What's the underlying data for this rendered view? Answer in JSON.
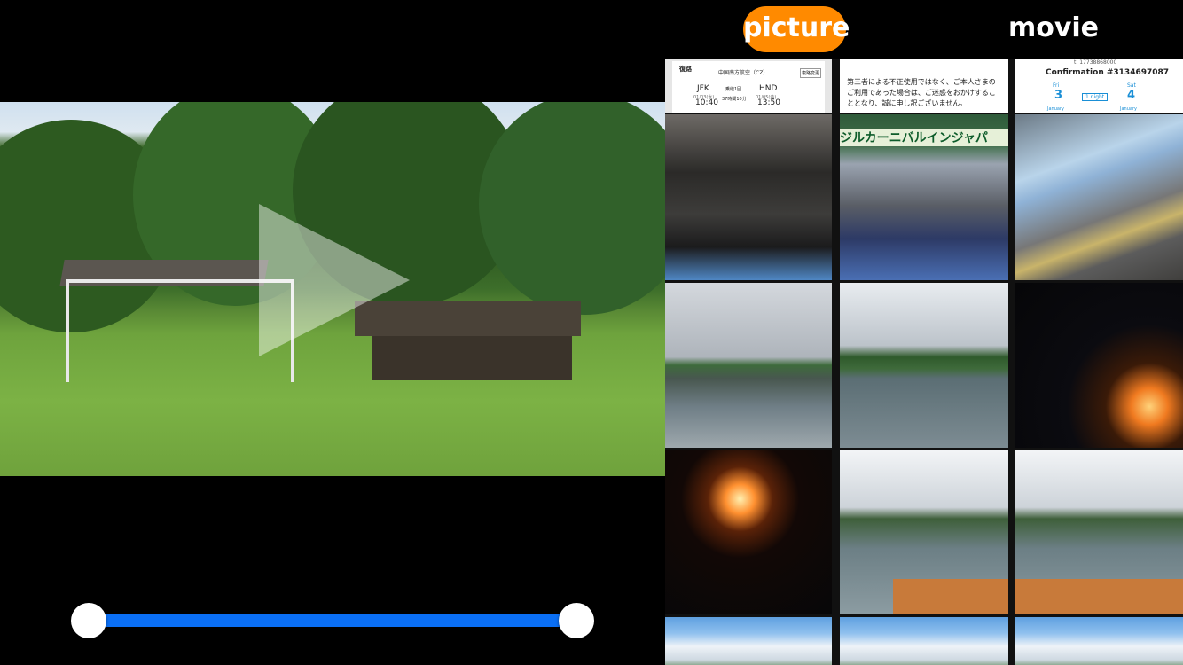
{
  "tabs": {
    "picture": "picture",
    "movie": "movie"
  },
  "accent_color": "#ff8a00",
  "slider_color": "#0a6ff5",
  "trim": {
    "start": 0.0,
    "end": 1.0
  },
  "thumbnails": {
    "ticket": {
      "header": "復路",
      "airline": "中国南方航空（CZ）",
      "change_button": "復路変更",
      "from_code": "JFK",
      "from_date": "01/03(水)",
      "from_time": "10:40",
      "connection": "乗継1回",
      "duration": "37時間10分",
      "to_code": "HND",
      "to_date": "01/05(金)",
      "to_time": "13:50"
    },
    "notice": {
      "line1": "第三者による不正使用ではなく、ご本人さまの",
      "line2": "ご利用であった場合は、ご迷惑をおかけするこ",
      "line3": "ととなり、誠に申し訳ございません。"
    },
    "hotel": {
      "top_line": "t: 17738868000",
      "confirmation": "Confirmation #3134697087",
      "checkin_day": "Fri",
      "checkin_date": "3",
      "checkin_month": "January",
      "nights": "1 night",
      "checkout_day": "Sat",
      "checkout_date": "4",
      "checkout_month": "January"
    },
    "festival_banner": "ジルカーニバルインジャパ"
  }
}
